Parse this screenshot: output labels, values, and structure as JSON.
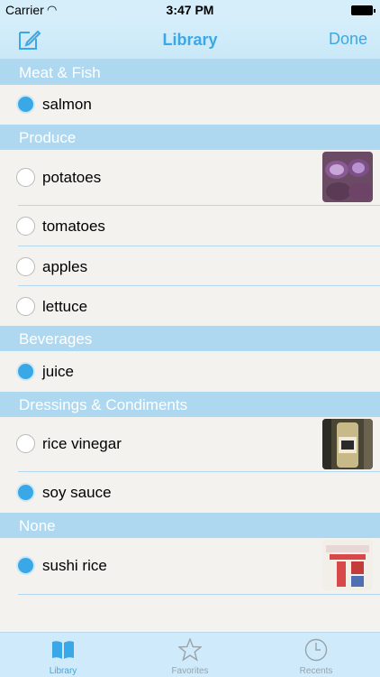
{
  "status_bar": {
    "carrier": "Carrier",
    "time": "3:47 PM"
  },
  "nav": {
    "title": "Library",
    "done_label": "Done"
  },
  "sections": [
    {
      "header": "Meat & Fish",
      "items": [
        {
          "label": "salmon",
          "selected": true
        }
      ]
    },
    {
      "header": "Produce",
      "items": [
        {
          "label": "potatoes",
          "selected": false,
          "thumbnail": "purple-potatoes-photo"
        },
        {
          "label": "tomatoes",
          "selected": false
        },
        {
          "label": "apples",
          "selected": false
        },
        {
          "label": "lettuce",
          "selected": false
        }
      ]
    },
    {
      "header": "Beverages",
      "items": [
        {
          "label": "juice",
          "selected": true
        }
      ]
    },
    {
      "header": "Dressings & Condiments",
      "items": [
        {
          "label": "rice vinegar",
          "selected": false,
          "thumbnail": "rice-vinegar-bottle-photo"
        },
        {
          "label": "soy sauce",
          "selected": true
        }
      ]
    },
    {
      "header": "None",
      "items": [
        {
          "label": "sushi rice",
          "selected": true,
          "thumbnail": "sushi-rice-bag-photo"
        }
      ]
    }
  ],
  "tabs": [
    {
      "label": "Library",
      "active": true
    },
    {
      "label": "Favorites",
      "active": false
    },
    {
      "label": "Recents",
      "active": false
    }
  ],
  "colors": {
    "accent": "#3aa8e6",
    "section_header": "#aed8f0",
    "inactive_tab": "#9aa3a8"
  }
}
